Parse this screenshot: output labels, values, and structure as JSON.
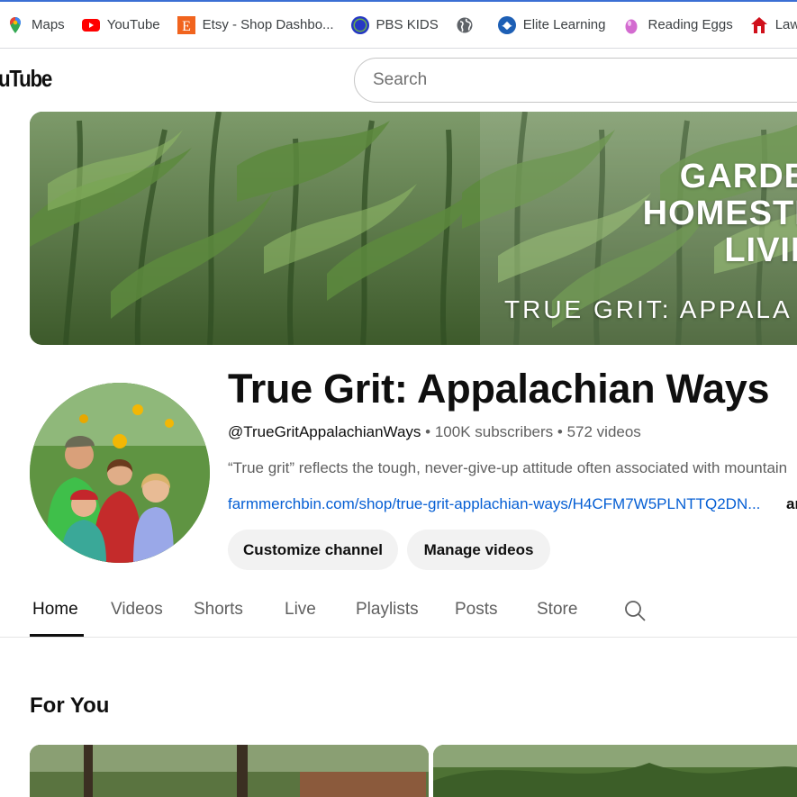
{
  "bookmarks": [
    {
      "label": "Maps",
      "icon": "maps-pin-icon"
    },
    {
      "label": "YouTube",
      "icon": "youtube-icon"
    },
    {
      "label": "Etsy - Shop Dashbo...",
      "icon": "etsy-icon"
    },
    {
      "label": "PBS KIDS",
      "icon": "pbs-kids-icon"
    },
    {
      "label": "",
      "icon": "globe-icon"
    },
    {
      "label": "Elite Learning",
      "icon": "elite-learning-icon"
    },
    {
      "label": "Reading Eggs",
      "icon": "reading-eggs-icon"
    },
    {
      "label": "Lawson",
      "icon": "lawson-icon"
    }
  ],
  "header": {
    "logo_text": "uTube",
    "search_placeholder": "Search"
  },
  "banner": {
    "lines": [
      "GARDENI",
      "HOMESTEA",
      "LIVING"
    ],
    "subtitle": "TRUE GRIT: APPALA"
  },
  "channel": {
    "title": "True Grit: Appalachian Ways",
    "handle": "@TrueGritAppalachianWays",
    "subscribers": "100K subscribers",
    "videos": "572 videos",
    "separator": " • ",
    "description": "“True grit” reflects the tough, never-give-up attitude often associated with mountain",
    "link": "farmmerchbin.com/shop/true-grit-applachian-ways/H4CFM7W5PLNTTQ2DN...",
    "link_more": "and",
    "customize_label": "Customize channel",
    "manage_label": "Manage videos"
  },
  "tabs": [
    {
      "label": "Home",
      "active": true
    },
    {
      "label": "Videos",
      "active": false
    },
    {
      "label": "Shorts",
      "active": false
    },
    {
      "label": "Live",
      "active": false
    },
    {
      "label": "Playlists",
      "active": false
    },
    {
      "label": "Posts",
      "active": false
    },
    {
      "label": "Store",
      "active": false
    }
  ],
  "section": {
    "title": "For You"
  },
  "colors": {
    "link": "#065fd4",
    "button_bg": "#f2f2f2",
    "text_primary": "#0f0f0f",
    "text_secondary": "#606060"
  }
}
